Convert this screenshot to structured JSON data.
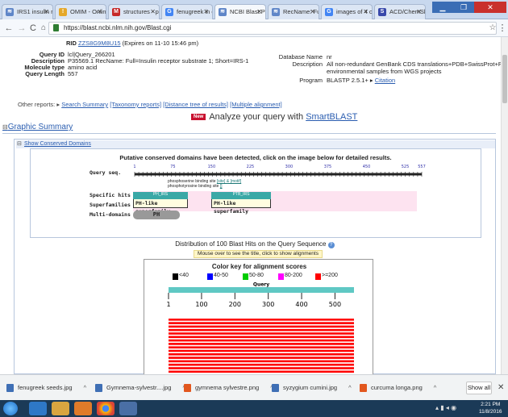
{
  "tabs": [
    {
      "label": "IRS1 insulin rec",
      "color": "#5f86c8",
      "glyph": "≋",
      "active": false
    },
    {
      "label": "OMIM - Online",
      "color": "#e5a82a",
      "glyph": "!",
      "active": false
    },
    {
      "label": "structures - pri",
      "color": "#c62828",
      "glyph": "M",
      "active": false
    },
    {
      "label": "fenugreek in di",
      "color": "#4285f4",
      "glyph": "G",
      "active": false
    },
    {
      "label": "NCBI Blast:P355",
      "color": "#5f86c8",
      "glyph": "≋",
      "active": true
    },
    {
      "label": "RecName: Full",
      "color": "#5f86c8",
      "glyph": "≋",
      "active": false
    },
    {
      "label": "images of 4 coc",
      "color": "#4285f4",
      "glyph": "G",
      "active": false
    },
    {
      "label": "ACD/ChemSke",
      "color": "#3949ab",
      "glyph": "S",
      "active": false
    }
  ],
  "url": "https://blast.ncbi.nlm.nih.gov/Blast.cgi",
  "rid_row": {
    "key": "RID",
    "value": "ZZS8G9M8U15",
    "suffix": "(Expires on 11-10 15:46 pm)"
  },
  "left_fields": [
    {
      "key": "Query ID",
      "value": "lcl|Query_266201"
    },
    {
      "key": "Description",
      "value": "P35569.1 RecName: Full=Insulin receptor substrate 1; Short=IRS-1"
    },
    {
      "key": "Molecule type",
      "value": "amino acid"
    },
    {
      "key": "Query Length",
      "value": "557"
    }
  ],
  "right_fields": {
    "db_key": "Database Name",
    "db_value": "nr",
    "desc_key": "Description",
    "desc_line1": "All non-redundant GenBank CDS translations+PDB+SwissProt+PIR+PRF excluding",
    "desc_line2": "environmental samples from WGS projects",
    "program_key": "Program",
    "program_value": "BLASTP 2.5.1+",
    "citation": "Citation"
  },
  "other_reports": {
    "label": "Other reports:",
    "links": [
      "Search Summary",
      "[Taxonomy reports]",
      "[Distance tree of results]",
      "[Multiple alignment]"
    ]
  },
  "smartblast": {
    "badge": "New",
    "text": "Analyze your query with ",
    "link": "SmartBLAST"
  },
  "graphic_summary": "Graphic Summary",
  "show_cd": "Show Conserved Domains",
  "cd_title": "Putative conserved domains have been detected, click on the image below for detailed results.",
  "query_seq_label": "Query seq.",
  "ruler_ticks": [
    "1",
    "75",
    "150",
    "225",
    "300",
    "375",
    "450",
    "525",
    "557"
  ],
  "site_labels": {
    "line1": "phosphoserine binding site",
    "line1_link": "[site] & [motif]",
    "line2": "phosphotyrosine binding site",
    "line2_link": "[]"
  },
  "track_labels": [
    "Specific hits",
    "Superfamilies",
    "Multi-domains"
  ],
  "specific_hits": [
    {
      "label": "PH_IRS"
    },
    {
      "label": "PTB_IRS"
    }
  ],
  "superfamilies": [
    {
      "label": "PH-like superfamily"
    },
    {
      "label": "PH-like superfamily"
    }
  ],
  "multidomain": {
    "label": "PH"
  },
  "dist_title": "Distribution of 100 Blast Hits on the Query Sequence",
  "mouse_hint": "Mouse over to see the title, click to show alignments",
  "color_key_title": "Color key for alignment scores",
  "color_key": [
    {
      "label": "<40",
      "color": "#000000"
    },
    {
      "label": "40-50",
      "color": "#0000ff"
    },
    {
      "label": "50-80",
      "color": "#00cc00"
    },
    {
      "label": "80-200",
      "color": "#ff00ff"
    },
    {
      "label": ">=200",
      "color": "#ff0000"
    }
  ],
  "query_label": "Query",
  "axis_ticks": [
    "1",
    "100",
    "200",
    "300",
    "400",
    "500"
  ],
  "hit_count_shown": 16,
  "downloads": [
    {
      "name": "fenugreek seeds.jpg",
      "color": "#3f6fb5"
    },
    {
      "name": "Gymnema-sylvestr....jpg",
      "color": "#3f6fb5"
    },
    {
      "name": "gymnema sylvestre.png",
      "color": "#e2571e"
    },
    {
      "name": "syzygium cumini.jpg",
      "color": "#3f6fb5"
    },
    {
      "name": "curcuma longa.png",
      "color": "#e2571e"
    }
  ],
  "show_all": "Show all",
  "clock": {
    "time": "2:21 PM",
    "date": "11/8/2016"
  }
}
